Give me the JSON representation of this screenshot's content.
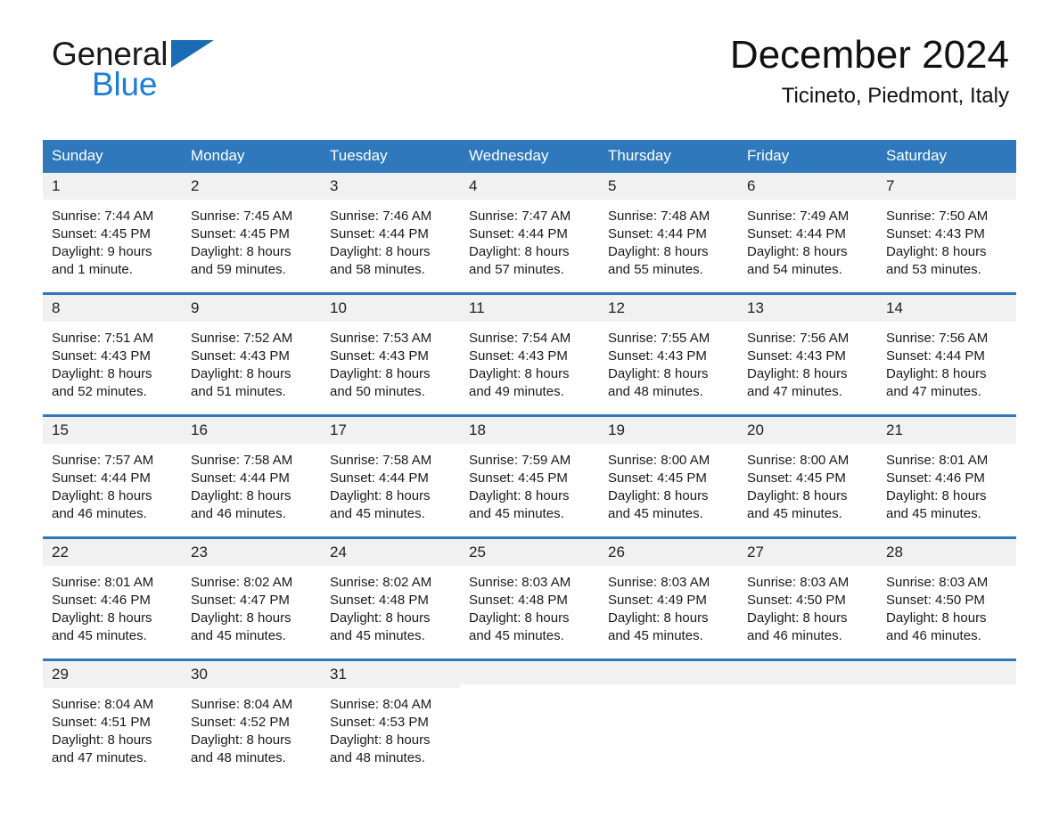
{
  "brand": {
    "line1": "General",
    "line2": "Blue",
    "triangle_color": "#1a6db5",
    "text_color": "#1c7fd4"
  },
  "header": {
    "month_title": "December 2024",
    "location": "Ticineto, Piedmont, Italy"
  },
  "theme": {
    "header_blue": "#2e78bb",
    "day_band": "#f1f1f1",
    "text": "#1a1a1a"
  },
  "weekdays": [
    "Sunday",
    "Monday",
    "Tuesday",
    "Wednesday",
    "Thursday",
    "Friday",
    "Saturday"
  ],
  "weeks": [
    [
      {
        "day": "1",
        "sunrise": "Sunrise: 7:44 AM",
        "sunset": "Sunset: 4:45 PM",
        "daylight1": "Daylight: 9 hours",
        "daylight2": "and 1 minute."
      },
      {
        "day": "2",
        "sunrise": "Sunrise: 7:45 AM",
        "sunset": "Sunset: 4:45 PM",
        "daylight1": "Daylight: 8 hours",
        "daylight2": "and 59 minutes."
      },
      {
        "day": "3",
        "sunrise": "Sunrise: 7:46 AM",
        "sunset": "Sunset: 4:44 PM",
        "daylight1": "Daylight: 8 hours",
        "daylight2": "and 58 minutes."
      },
      {
        "day": "4",
        "sunrise": "Sunrise: 7:47 AM",
        "sunset": "Sunset: 4:44 PM",
        "daylight1": "Daylight: 8 hours",
        "daylight2": "and 57 minutes."
      },
      {
        "day": "5",
        "sunrise": "Sunrise: 7:48 AM",
        "sunset": "Sunset: 4:44 PM",
        "daylight1": "Daylight: 8 hours",
        "daylight2": "and 55 minutes."
      },
      {
        "day": "6",
        "sunrise": "Sunrise: 7:49 AM",
        "sunset": "Sunset: 4:44 PM",
        "daylight1": "Daylight: 8 hours",
        "daylight2": "and 54 minutes."
      },
      {
        "day": "7",
        "sunrise": "Sunrise: 7:50 AM",
        "sunset": "Sunset: 4:43 PM",
        "daylight1": "Daylight: 8 hours",
        "daylight2": "and 53 minutes."
      }
    ],
    [
      {
        "day": "8",
        "sunrise": "Sunrise: 7:51 AM",
        "sunset": "Sunset: 4:43 PM",
        "daylight1": "Daylight: 8 hours",
        "daylight2": "and 52 minutes."
      },
      {
        "day": "9",
        "sunrise": "Sunrise: 7:52 AM",
        "sunset": "Sunset: 4:43 PM",
        "daylight1": "Daylight: 8 hours",
        "daylight2": "and 51 minutes."
      },
      {
        "day": "10",
        "sunrise": "Sunrise: 7:53 AM",
        "sunset": "Sunset: 4:43 PM",
        "daylight1": "Daylight: 8 hours",
        "daylight2": "and 50 minutes."
      },
      {
        "day": "11",
        "sunrise": "Sunrise: 7:54 AM",
        "sunset": "Sunset: 4:43 PM",
        "daylight1": "Daylight: 8 hours",
        "daylight2": "and 49 minutes."
      },
      {
        "day": "12",
        "sunrise": "Sunrise: 7:55 AM",
        "sunset": "Sunset: 4:43 PM",
        "daylight1": "Daylight: 8 hours",
        "daylight2": "and 48 minutes."
      },
      {
        "day": "13",
        "sunrise": "Sunrise: 7:56 AM",
        "sunset": "Sunset: 4:43 PM",
        "daylight1": "Daylight: 8 hours",
        "daylight2": "and 47 minutes."
      },
      {
        "day": "14",
        "sunrise": "Sunrise: 7:56 AM",
        "sunset": "Sunset: 4:44 PM",
        "daylight1": "Daylight: 8 hours",
        "daylight2": "and 47 minutes."
      }
    ],
    [
      {
        "day": "15",
        "sunrise": "Sunrise: 7:57 AM",
        "sunset": "Sunset: 4:44 PM",
        "daylight1": "Daylight: 8 hours",
        "daylight2": "and 46 minutes."
      },
      {
        "day": "16",
        "sunrise": "Sunrise: 7:58 AM",
        "sunset": "Sunset: 4:44 PM",
        "daylight1": "Daylight: 8 hours",
        "daylight2": "and 46 minutes."
      },
      {
        "day": "17",
        "sunrise": "Sunrise: 7:58 AM",
        "sunset": "Sunset: 4:44 PM",
        "daylight1": "Daylight: 8 hours",
        "daylight2": "and 45 minutes."
      },
      {
        "day": "18",
        "sunrise": "Sunrise: 7:59 AM",
        "sunset": "Sunset: 4:45 PM",
        "daylight1": "Daylight: 8 hours",
        "daylight2": "and 45 minutes."
      },
      {
        "day": "19",
        "sunrise": "Sunrise: 8:00 AM",
        "sunset": "Sunset: 4:45 PM",
        "daylight1": "Daylight: 8 hours",
        "daylight2": "and 45 minutes."
      },
      {
        "day": "20",
        "sunrise": "Sunrise: 8:00 AM",
        "sunset": "Sunset: 4:45 PM",
        "daylight1": "Daylight: 8 hours",
        "daylight2": "and 45 minutes."
      },
      {
        "day": "21",
        "sunrise": "Sunrise: 8:01 AM",
        "sunset": "Sunset: 4:46 PM",
        "daylight1": "Daylight: 8 hours",
        "daylight2": "and 45 minutes."
      }
    ],
    [
      {
        "day": "22",
        "sunrise": "Sunrise: 8:01 AM",
        "sunset": "Sunset: 4:46 PM",
        "daylight1": "Daylight: 8 hours",
        "daylight2": "and 45 minutes."
      },
      {
        "day": "23",
        "sunrise": "Sunrise: 8:02 AM",
        "sunset": "Sunset: 4:47 PM",
        "daylight1": "Daylight: 8 hours",
        "daylight2": "and 45 minutes."
      },
      {
        "day": "24",
        "sunrise": "Sunrise: 8:02 AM",
        "sunset": "Sunset: 4:48 PM",
        "daylight1": "Daylight: 8 hours",
        "daylight2": "and 45 minutes."
      },
      {
        "day": "25",
        "sunrise": "Sunrise: 8:03 AM",
        "sunset": "Sunset: 4:48 PM",
        "daylight1": "Daylight: 8 hours",
        "daylight2": "and 45 minutes."
      },
      {
        "day": "26",
        "sunrise": "Sunrise: 8:03 AM",
        "sunset": "Sunset: 4:49 PM",
        "daylight1": "Daylight: 8 hours",
        "daylight2": "and 45 minutes."
      },
      {
        "day": "27",
        "sunrise": "Sunrise: 8:03 AM",
        "sunset": "Sunset: 4:50 PM",
        "daylight1": "Daylight: 8 hours",
        "daylight2": "and 46 minutes."
      },
      {
        "day": "28",
        "sunrise": "Sunrise: 8:03 AM",
        "sunset": "Sunset: 4:50 PM",
        "daylight1": "Daylight: 8 hours",
        "daylight2": "and 46 minutes."
      }
    ],
    [
      {
        "day": "29",
        "sunrise": "Sunrise: 8:04 AM",
        "sunset": "Sunset: 4:51 PM",
        "daylight1": "Daylight: 8 hours",
        "daylight2": "and 47 minutes."
      },
      {
        "day": "30",
        "sunrise": "Sunrise: 8:04 AM",
        "sunset": "Sunset: 4:52 PM",
        "daylight1": "Daylight: 8 hours",
        "daylight2": "and 48 minutes."
      },
      {
        "day": "31",
        "sunrise": "Sunrise: 8:04 AM",
        "sunset": "Sunset: 4:53 PM",
        "daylight1": "Daylight: 8 hours",
        "daylight2": "and 48 minutes."
      },
      {
        "day": "",
        "sunrise": "",
        "sunset": "",
        "daylight1": "",
        "daylight2": ""
      },
      {
        "day": "",
        "sunrise": "",
        "sunset": "",
        "daylight1": "",
        "daylight2": ""
      },
      {
        "day": "",
        "sunrise": "",
        "sunset": "",
        "daylight1": "",
        "daylight2": ""
      },
      {
        "day": "",
        "sunrise": "",
        "sunset": "",
        "daylight1": "",
        "daylight2": ""
      }
    ]
  ]
}
